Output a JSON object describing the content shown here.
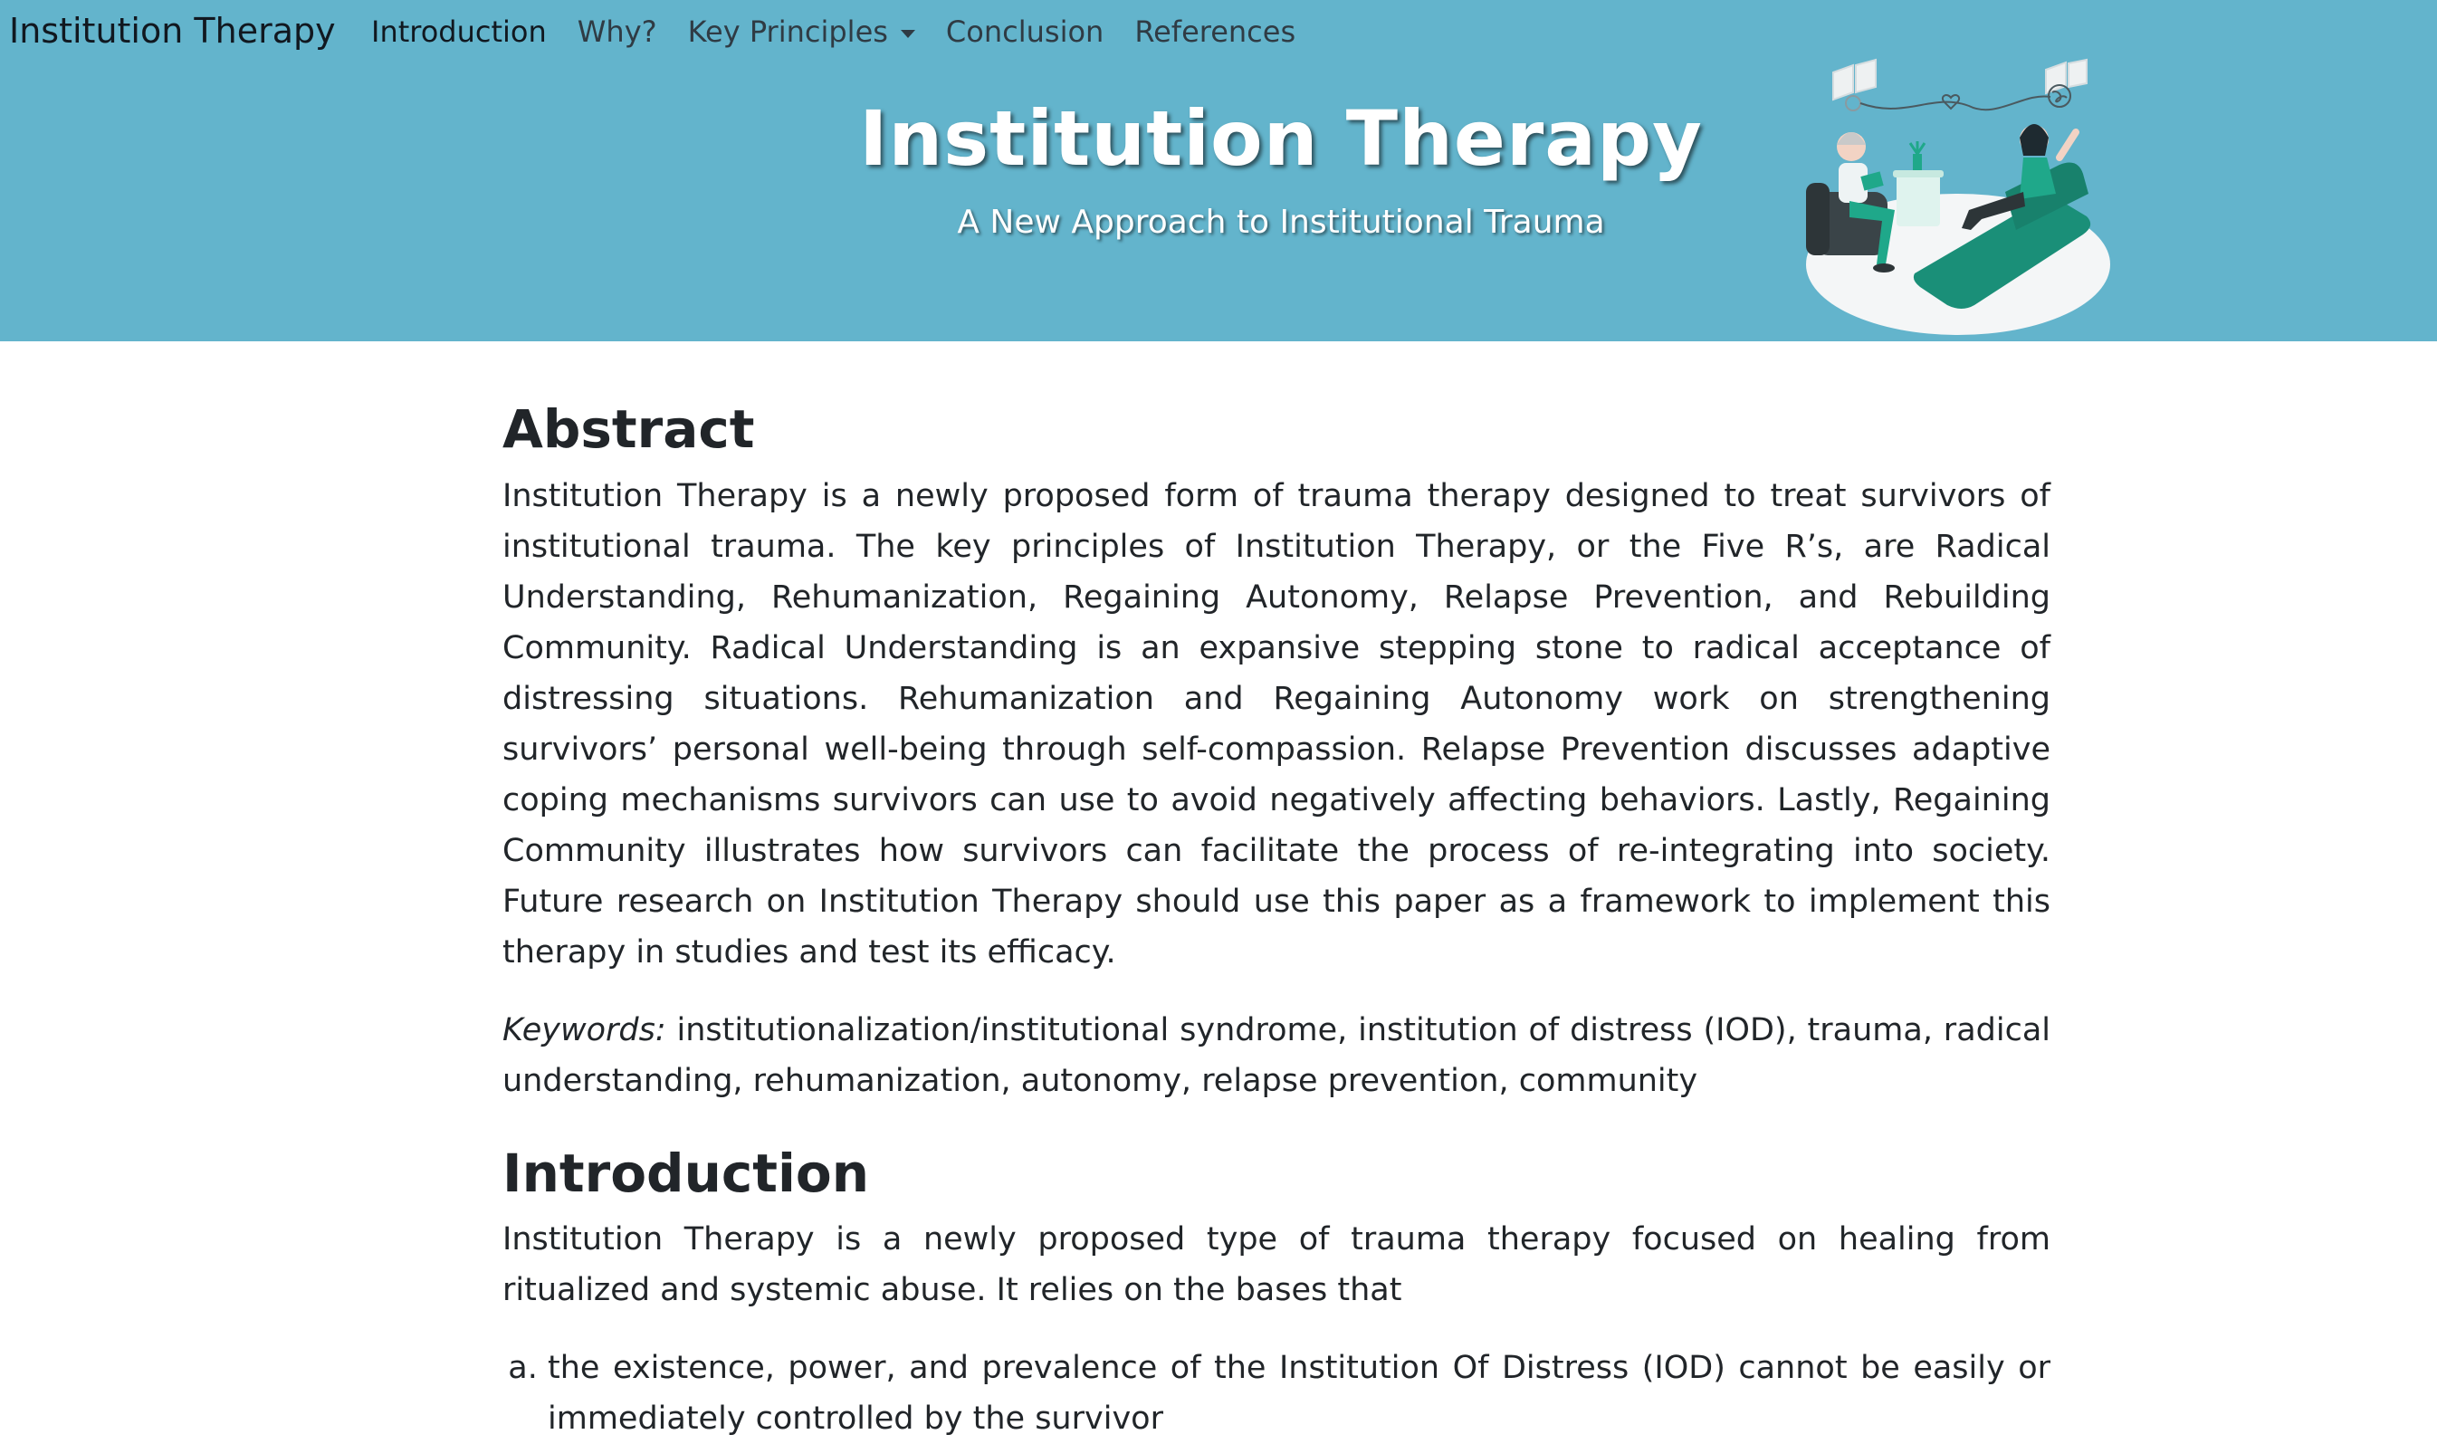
{
  "navbar": {
    "brand": "Institution Therapy",
    "items": [
      {
        "label": "Introduction"
      },
      {
        "label": "Why?"
      },
      {
        "label": "Key Principles"
      },
      {
        "label": "Conclusion"
      },
      {
        "label": "References"
      }
    ]
  },
  "hero": {
    "title": "Institution Therapy",
    "subtitle": "A New Approach to Institutional Trauma",
    "illustration_icon": "therapy-session-illustration"
  },
  "colors": {
    "header_bg": "#63b4cc",
    "accent_teal": "#1fa88a"
  },
  "abstract": {
    "heading": "Abstract",
    "body": "Institution Therapy is a newly proposed form of trauma therapy designed to treat survivors of institutional trauma. The key principles of Institution Therapy, or the Five R’s, are Radical Understanding, Rehumanization, Regaining Autonomy, Relapse Prevention, and Rebuilding Community. Radical Understanding is an expansive stepping stone to radical acceptance of distressing situations. Rehumanization and Regaining Autonomy work on strengthening survivors’ personal well-being through self-compassion. Relapse Prevention discusses adaptive coping mechanisms survivors can use to avoid negatively affecting behaviors. Lastly, Regaining Community illustrates how survivors can facilitate the process of re-integrating into society. Future research on Institution Therapy should use this paper as a framework to implement this therapy in studies and test its efficacy.",
    "keywords_label": "Keywords:",
    "keywords": " institutionalization/institutional syndrome, institution of distress (IOD), trauma, radical understanding, rehumanization, autonomy, relapse prevention, community"
  },
  "introduction": {
    "heading": "Introduction",
    "body": "Institution Therapy is a newly proposed type of trauma therapy focused on healing from ritualized and systemic abuse. It relies on the bases that",
    "list": [
      "the existence, power, and prevalence of the Institution Of Distress (IOD) cannot be easily or immediately controlled by the survivor"
    ]
  }
}
